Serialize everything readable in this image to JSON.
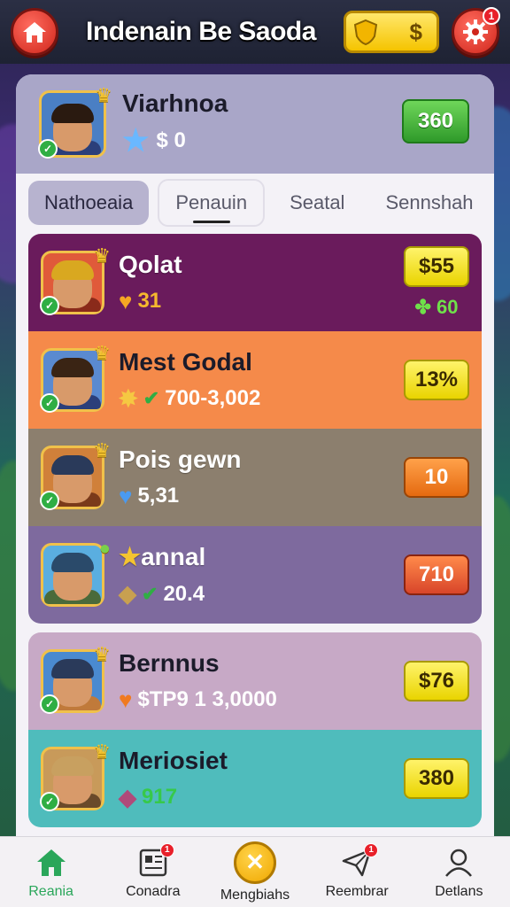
{
  "header": {
    "title": "Indenain Be Saoda",
    "coin_value": "$",
    "settings_badge": "1"
  },
  "profile": {
    "name": "Viarhnoa",
    "sub_value": "$ 0",
    "score": "360"
  },
  "tabs": [
    {
      "label": "Nathoeaia"
    },
    {
      "label": "Penauin"
    },
    {
      "label": "Seatal"
    },
    {
      "label": "Sennshah"
    }
  ],
  "rows": [
    {
      "name": "Qolat",
      "stat": "31",
      "value": "$55",
      "sub_value": "60",
      "bg": "#6a1b5c",
      "pill": "yellow",
      "stat_color": "#f5b82e",
      "icon": "heart-icon"
    },
    {
      "name": "Mest Godal",
      "stat": "700-3,002",
      "value": "13%",
      "bg": "#f58a4a",
      "pill": "yellow",
      "stat_color": "#ffffff",
      "icon": "puzzle-icon"
    },
    {
      "name": "Pois gewn",
      "stat": "5,31",
      "value": "10",
      "bg": "#8c7f6e",
      "pill": "orange",
      "stat_color": "#ffffff",
      "icon": "heart-icon"
    },
    {
      "name": "annal",
      "stat": "20.4",
      "value": "710",
      "bg": "#7e6a9e",
      "pill": "red",
      "stat_color": "#ffffff",
      "icon": "gem-icon"
    },
    {
      "name": "Bernnus",
      "stat": "$TP9 1 3,0000",
      "value": "$76",
      "bg": "#c7a9c6",
      "pill": "yellow",
      "stat_color": "#ffffff",
      "icon": "heart-icon"
    },
    {
      "name": "Meriosiet",
      "stat": "917",
      "value": "380",
      "bg": "#4fbcbc",
      "pill": "yellow",
      "stat_color": "#37c94a",
      "icon": "gem-icon"
    }
  ],
  "nav": [
    {
      "label": "Reania",
      "icon": "home-icon"
    },
    {
      "label": "Conadra",
      "icon": "news-icon",
      "badge": "1"
    },
    {
      "label": "Mengbiahs",
      "icon": "close-icon"
    },
    {
      "label": "Reembrar",
      "icon": "send-icon",
      "badge": "1"
    },
    {
      "label": "Detlans",
      "icon": "user-icon"
    }
  ]
}
